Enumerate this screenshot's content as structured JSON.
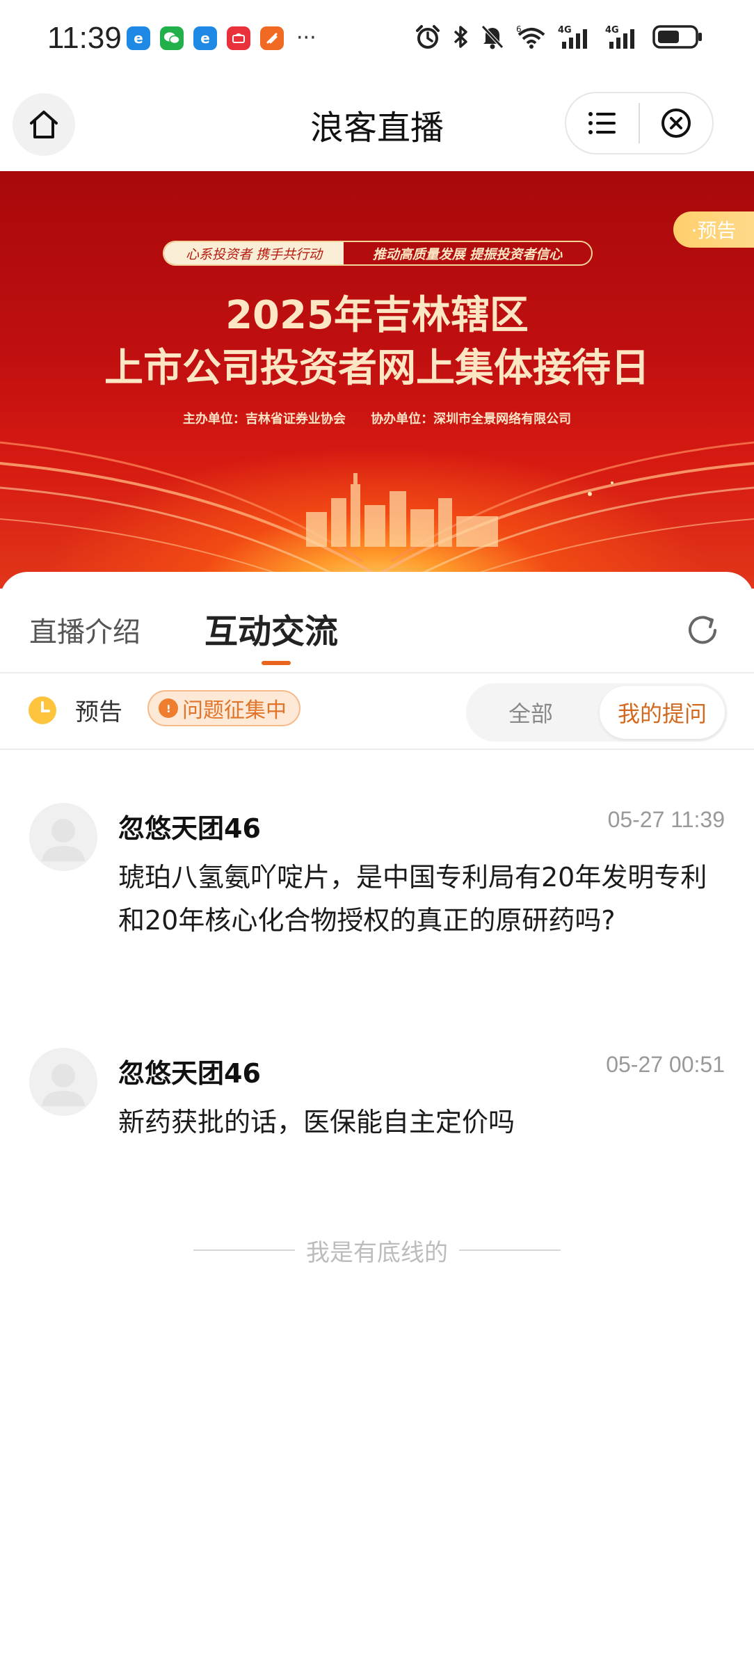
{
  "status_bar": {
    "time": "11:39",
    "notifications": [
      {
        "icon": "app-e-icon",
        "color": "#1e88e5"
      },
      {
        "icon": "wechat-icon",
        "color": "#22b04b"
      },
      {
        "icon": "app-e-icon",
        "color": "#1e88e5"
      },
      {
        "icon": "huawei-icon",
        "color": "#e8313a"
      },
      {
        "icon": "app-orange-icon",
        "color": "#f06a23"
      }
    ],
    "more": "···",
    "network_1": "4G",
    "network_2": "4G",
    "wifi_label": "6"
  },
  "header": {
    "title": "浪客直播"
  },
  "banner": {
    "slogan_left": "心系投资者 携手共行动",
    "slogan_right": "推动高质量发展 提振投资者信心",
    "title_line1": "2025年吉林辖区",
    "title_line2": "上市公司投资者网上集体接待日",
    "organizer": "主办单位：吉林省证券业协会",
    "co_organizer": "协办单位：深圳市全景网络有限公司",
    "badge": "·预告"
  },
  "tabs": {
    "intro": "直播介绍",
    "interact": "互动交流"
  },
  "filter": {
    "status": "预告",
    "collect_badge": "问题征集中",
    "seg_all": "全部",
    "seg_mine": "我的提问"
  },
  "questions": [
    {
      "user": "忽悠天团46",
      "time": "05-27 11:39",
      "text": "琥珀八氢氨吖啶片，是中国专利局有20年发明专利和20年核心化合物授权的真正的原研药吗?"
    },
    {
      "user": "忽悠天团46",
      "time": "05-27 00:51",
      "text": "新药获批的话，医保能自主定价吗"
    }
  ],
  "footer": {
    "end_text": "我是有底线的"
  },
  "colors": {
    "accent": "#e8641f",
    "banner_red": "#c10f10",
    "badge_yellow": "#ffcf6b"
  }
}
